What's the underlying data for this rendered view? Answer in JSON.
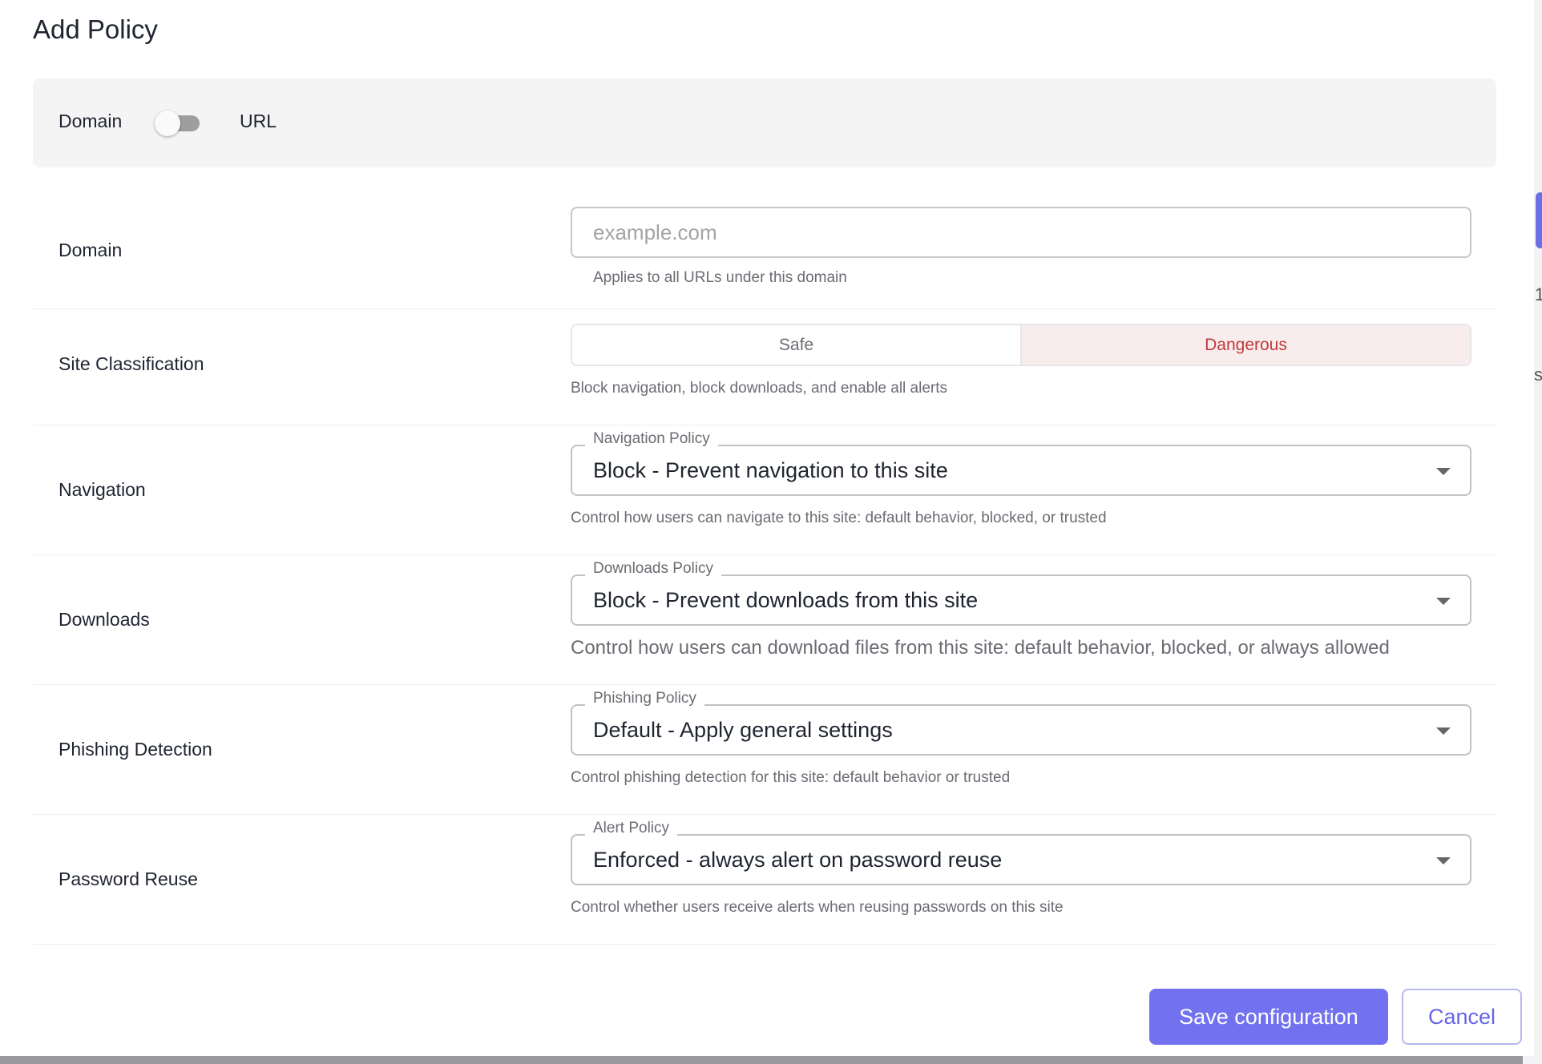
{
  "dialog": {
    "title": "Add Policy",
    "mode": {
      "left_label": "Domain",
      "right_label": "URL",
      "selected": "Domain"
    }
  },
  "domain_row": {
    "label": "Domain",
    "input_value": "",
    "placeholder": "example.com",
    "helper": "Applies to all URLs under this domain"
  },
  "classification_row": {
    "label": "Site Classification",
    "options": [
      "Safe",
      "Dangerous"
    ],
    "selected": "Dangerous",
    "helper": "Block navigation, block downloads, and enable all alerts"
  },
  "navigation_row": {
    "label": "Navigation",
    "select_label": "Navigation Policy",
    "value": "Block - Prevent navigation to this site",
    "helper": "Control how users can navigate to this site: default behavior, blocked, or trusted"
  },
  "downloads_row": {
    "label": "Downloads",
    "select_label": "Downloads Policy",
    "value": "Block - Prevent downloads from this site",
    "helper": "Control how users can download files from this site: default behavior, blocked, or always allowed"
  },
  "phishing_row": {
    "label": "Phishing Detection",
    "select_label": "Phishing Policy",
    "value": "Default - Apply general settings",
    "helper": "Control phishing detection for this site: default behavior or trusted"
  },
  "password_row": {
    "label": "Password Reuse",
    "select_label": "Alert Policy",
    "value": "Enforced - always alert on password reuse",
    "helper": "Control whether users receive alerts when reusing passwords on this site"
  },
  "actions": {
    "save": "Save configuration",
    "cancel": "Cancel"
  },
  "background": {
    "glyph_1": "1",
    "glyph_2": "s"
  },
  "colors": {
    "accent": "#7272f0",
    "danger_text": "#c0393b",
    "danger_bg": "#f9ecec",
    "mode_bar_bg": "#f4f4f5"
  },
  "icons": {
    "select_caret": "chevron-down-icon"
  }
}
